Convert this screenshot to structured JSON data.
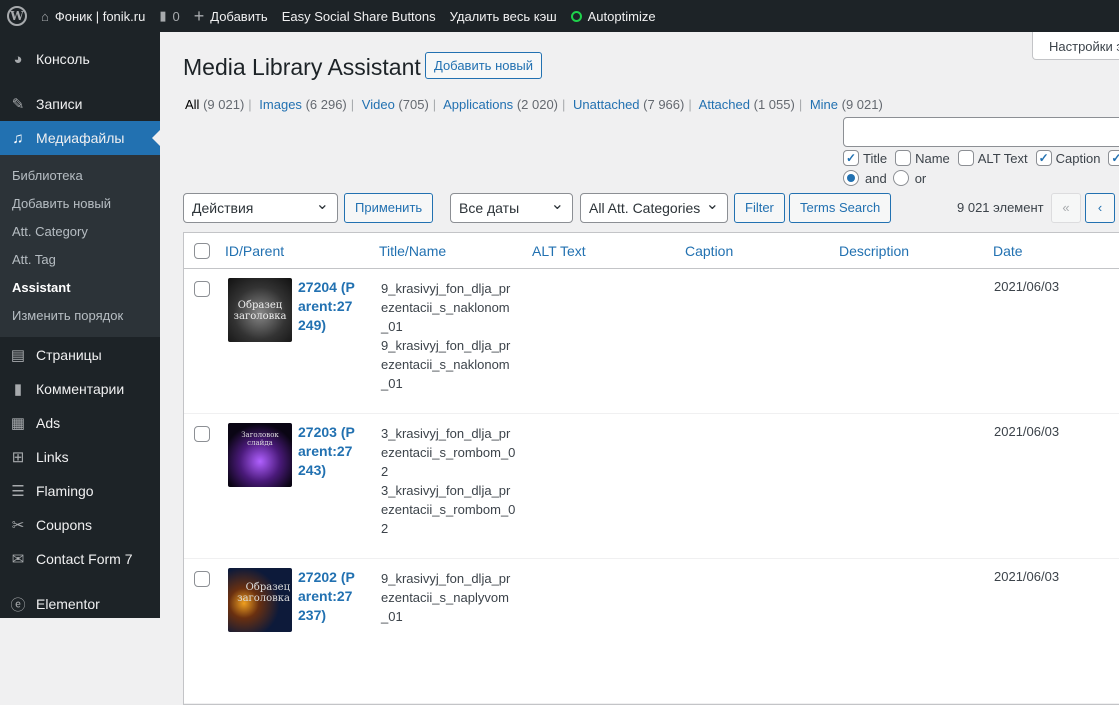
{
  "adminbar": {
    "site": "Фоник | fonik.ru",
    "comments": "0",
    "add": "Добавить",
    "essb": "Easy Social Share Buttons",
    "cache": "Удалить весь кэш",
    "autoptimize": "Autoptimize"
  },
  "sidebar": {
    "items": [
      {
        "label": "Консоль"
      },
      {
        "label": "Записи"
      },
      {
        "label": "Медиафайлы"
      },
      {
        "label": "Страницы"
      },
      {
        "label": "Комментарии"
      },
      {
        "label": "Ads"
      },
      {
        "label": "Links"
      },
      {
        "label": "Flamingo"
      },
      {
        "label": "Coupons"
      },
      {
        "label": "Contact Form 7"
      },
      {
        "label": "Elementor"
      }
    ],
    "submenu": [
      "Библиотека",
      "Добавить новый",
      "Att. Category",
      "Att. Tag",
      "Assistant",
      "Изменить порядок"
    ]
  },
  "page": {
    "screen_options": "Настройки экрана",
    "title": "Media Library Assistant",
    "add_new": "Добавить новый",
    "views": [
      {
        "label": "All",
        "count": "(9 021)"
      },
      {
        "label": "Images",
        "count": "(6 296)"
      },
      {
        "label": "Video",
        "count": "(705)"
      },
      {
        "label": "Applications",
        "count": "(2 020)"
      },
      {
        "label": "Unattached",
        "count": "(7 966)"
      },
      {
        "label": "Attached",
        "count": "(1 055)"
      },
      {
        "label": "Mine",
        "count": "(9 021)"
      }
    ],
    "search_value": "",
    "search_fields": [
      {
        "label": "Title",
        "checked": true
      },
      {
        "label": "Name",
        "checked": false
      },
      {
        "label": "ALT Text",
        "checked": false
      },
      {
        "label": "Caption",
        "checked": true
      }
    ],
    "connector": {
      "and": "and",
      "or": "or",
      "selected": "and"
    },
    "bulk_action": "Действия",
    "apply": "Применить",
    "dates": "Все даты",
    "categories": "All Att. Categories",
    "filter": "Filter",
    "terms_search": "Terms Search",
    "count": "9 021 элемент",
    "first": "«",
    "prev": "‹"
  },
  "table": {
    "columns": [
      "ID/Parent",
      "Title/Name",
      "ALT Text",
      "Caption",
      "Description",
      "Date"
    ],
    "rows": [
      {
        "id": "27204",
        "parent": "(Parent:27249)",
        "title": "9_krasivyj_fon_dlja_prezentacii_s_naklonom_01",
        "name": "9_krasivyj_fon_dlja_prezentacii_s_naklonom_01",
        "date": "2021/06/03",
        "thumb_text": "Образец заголовка"
      },
      {
        "id": "27203",
        "parent": "(Parent:27243)",
        "title": "3_krasivyj_fon_dlja_prezentacii_s_rombom_02",
        "name": "3_krasivyj_fon_dlja_prezentacii_s_rombom_02",
        "date": "2021/06/03",
        "thumb_text": "Заголовок слайда"
      },
      {
        "id": "27202",
        "parent": "(Parent:27237)",
        "title": "9_krasivyj_fon_dlja_prezentacii_s_naplyvom_01",
        "name": "",
        "date": "2021/06/03",
        "thumb_text": "Образец заголовка"
      }
    ]
  }
}
